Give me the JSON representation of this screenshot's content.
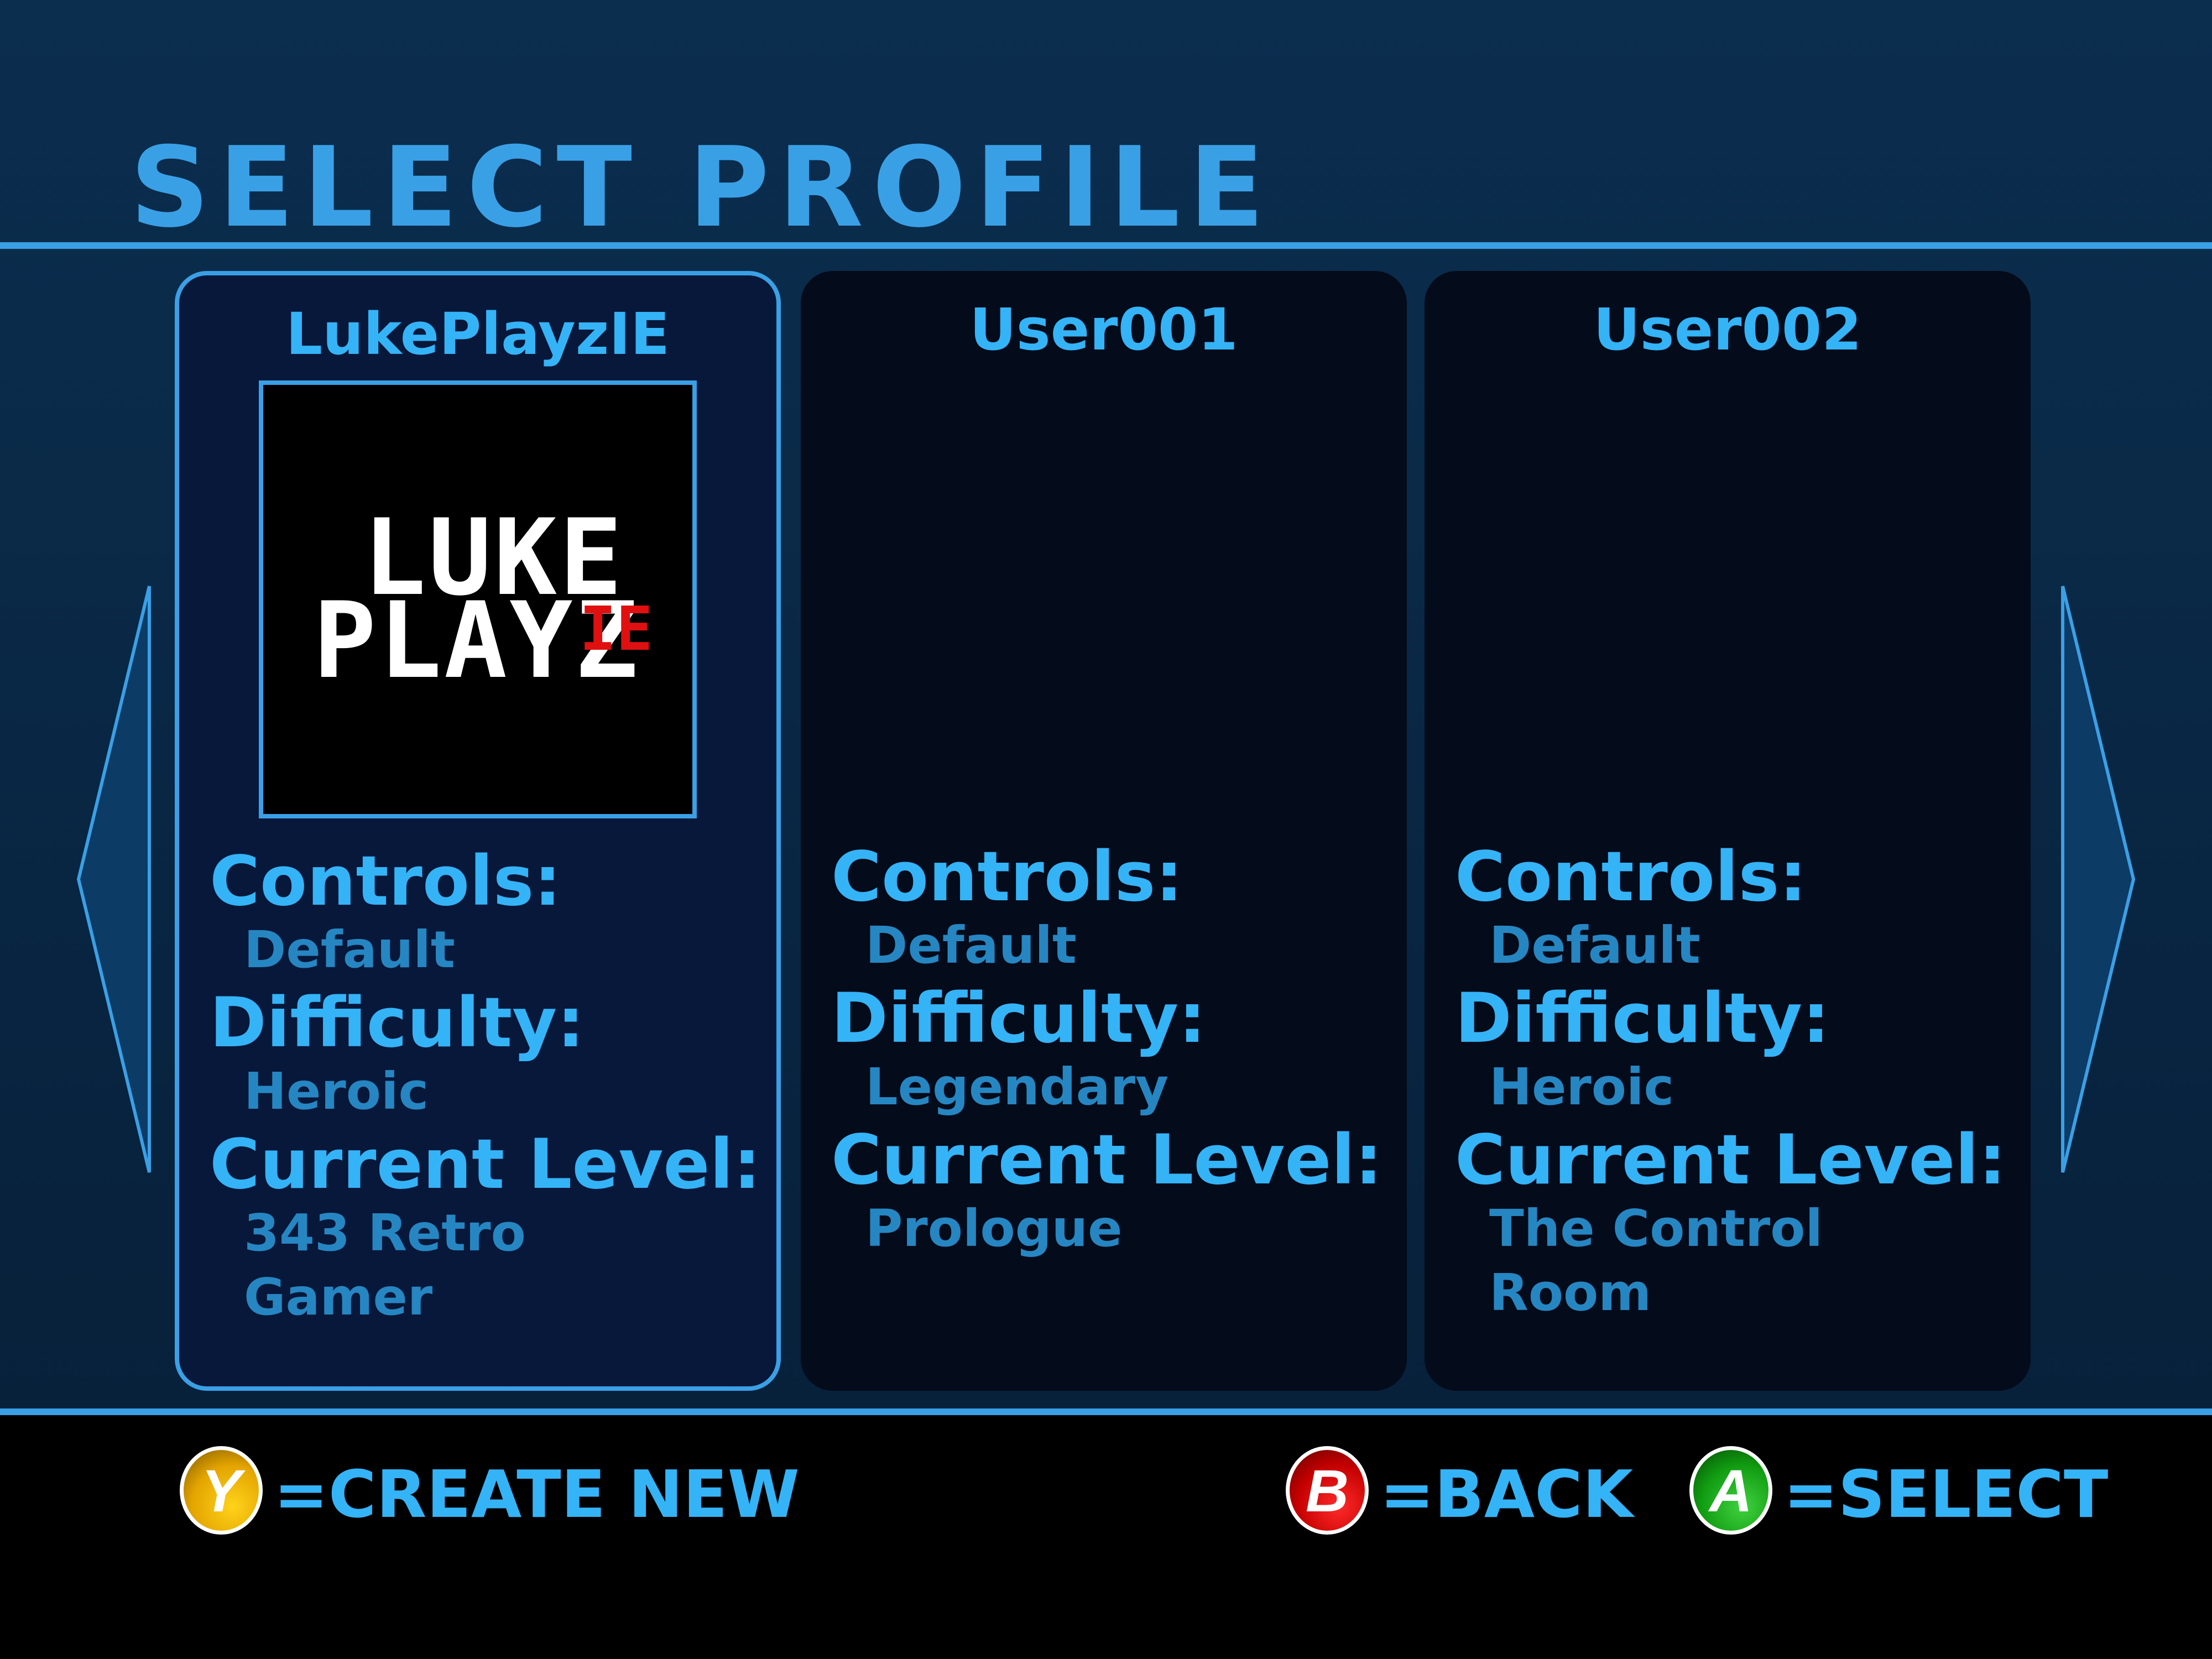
{
  "screen": {
    "title": "SELECT PROFILE"
  },
  "profiles": [
    {
      "name": "LukePlayzIE",
      "selected": true,
      "avatar": {
        "line1": "LUKE",
        "line2": "PLAYZ",
        "suffix": "IE"
      },
      "controls_label": "Controls:",
      "controls": "Default",
      "difficulty_label": "Difficulty:",
      "difficulty": "Heroic",
      "level_label": "Current Level:",
      "level": "343 Retro\nGamer"
    },
    {
      "name": "User001",
      "selected": false,
      "controls_label": "Controls:",
      "controls": "Default",
      "difficulty_label": "Difficulty:",
      "difficulty": "Legendary",
      "level_label": "Current Level:",
      "level": "Prologue"
    },
    {
      "name": "User002",
      "selected": false,
      "controls_label": "Controls:",
      "controls": "Default",
      "difficulty_label": "Difficulty:",
      "difficulty": "Heroic",
      "level_label": "Current Level:",
      "level": "The Control\nRoom"
    }
  ],
  "navigation": {
    "left_arrow_icon": "arrow-left-icon",
    "right_arrow_icon": "arrow-right-icon"
  },
  "hints": [
    {
      "button": "Y",
      "text": "=CREATE NEW",
      "color": "#f2b800"
    },
    {
      "button": "B",
      "text": "=BACK",
      "color": "#d90000"
    },
    {
      "button": "A",
      "text": "=SELECT",
      "color": "#1aa51a"
    }
  ],
  "colors": {
    "accent": "#3aa0e6",
    "label": "#35b3f7",
    "value": "#2686c2"
  }
}
